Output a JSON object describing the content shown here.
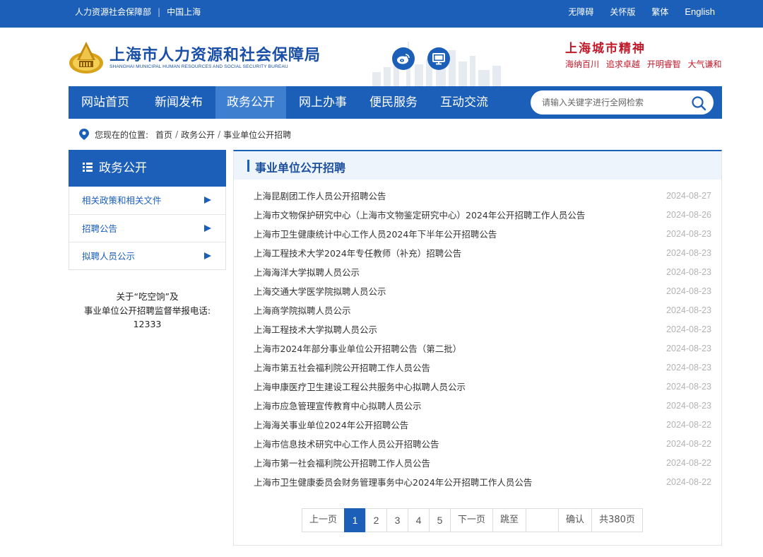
{
  "topbar": {
    "left": [
      "人力资源社会保障部",
      "中国上海"
    ],
    "right": [
      "无障碍",
      "关怀版",
      "繁体",
      "English"
    ]
  },
  "header": {
    "title": "上海市人力资源和社会保障局",
    "subtitle": "SHANGHAI MUNICIPAL HUMAN RESOURCES AND SOCIAL SECURITY BUREAU",
    "spirit_title": "上海城市精神",
    "spirit_items": [
      "海纳百川",
      "追求卓越",
      "开明睿智",
      "大气谦和"
    ],
    "icons": [
      "weibo-icon",
      "monitor-icon"
    ]
  },
  "nav": {
    "items": [
      "网站首页",
      "新闻发布",
      "政务公开",
      "网上办事",
      "便民服务",
      "互动交流"
    ],
    "active_index": 2,
    "search_placeholder": "请输入关键字进行全网检索"
  },
  "breadcrumb": {
    "label": "您现在的位置:",
    "items": [
      "首页",
      "政务公开",
      "事业单位公开招聘"
    ]
  },
  "sidebar": {
    "title": "政务公开",
    "items": [
      "相关政策和相关文件",
      "招聘公告",
      "拟聘人员公示"
    ],
    "note_line1": "关于“吃空饷”及",
    "note_line2": "事业单位公开招聘监督举报电话:",
    "note_line3": "12333"
  },
  "main": {
    "title": "事业单位公开招聘",
    "rows": [
      {
        "title": "上海昆剧团工作人员公开招聘公告",
        "date": "2024-08-27"
      },
      {
        "title": "上海市文物保护研究中心（上海市文物鉴定研究中心）2024年公开招聘工作人员公告",
        "date": "2024-08-26"
      },
      {
        "title": "上海市卫生健康统计中心工作人员2024年下半年公开招聘公告",
        "date": "2024-08-23"
      },
      {
        "title": "上海工程技术大学2024年专任教师（补充）招聘公告",
        "date": "2024-08-23"
      },
      {
        "title": "上海海洋大学拟聘人员公示",
        "date": "2024-08-23"
      },
      {
        "title": "上海交通大学医学院拟聘人员公示",
        "date": "2024-08-23"
      },
      {
        "title": "上海商学院拟聘人员公示",
        "date": "2024-08-23"
      },
      {
        "title": "上海工程技术大学拟聘人员公示",
        "date": "2024-08-23"
      },
      {
        "title": "上海市2024年部分事业单位公开招聘公告（第二批）",
        "date": "2024-08-23"
      },
      {
        "title": "上海市第五社会福利院公开招聘工作人员公告",
        "date": "2024-08-23"
      },
      {
        "title": "上海申康医疗卫生建设工程公共服务中心拟聘人员公示",
        "date": "2024-08-23"
      },
      {
        "title": "上海市应急管理宣传教育中心拟聘人员公示",
        "date": "2024-08-23"
      },
      {
        "title": "上海海关事业单位2024年公开招聘公告",
        "date": "2024-08-22"
      },
      {
        "title": "上海市信息技术研究中心工作人员公开招聘公告",
        "date": "2024-08-22"
      },
      {
        "title": "上海市第一社会福利院公开招聘工作人员公告",
        "date": "2024-08-22"
      },
      {
        "title": "上海市卫生健康委员会财务管理事务中心2024年公开招聘工作人员公告",
        "date": "2024-08-22"
      }
    ]
  },
  "pager": {
    "prev": "上一页",
    "pages": [
      "1",
      "2",
      "3",
      "4",
      "5"
    ],
    "current": "1",
    "next": "下一页",
    "jump": "跳至",
    "confirm": "确认",
    "total": "共380页"
  },
  "colors": {
    "brand_blue": "#1c5fb8",
    "nav_active": "#3f7fd0",
    "spirit_red": "#c0192a",
    "date_gray": "#b3b3b3"
  }
}
